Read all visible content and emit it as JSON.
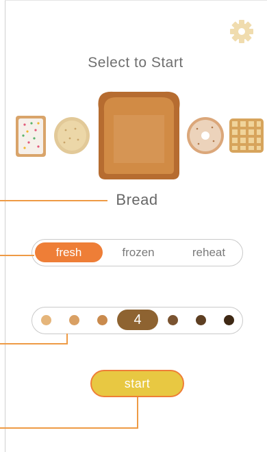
{
  "header": {
    "title": "Select to Start",
    "settings_icon": "gear-icon"
  },
  "carousel": {
    "items": [
      {
        "name": "toaster-pastry"
      },
      {
        "name": "english-muffin"
      },
      {
        "name": "bread",
        "selected": true
      },
      {
        "name": "bagel"
      },
      {
        "name": "waffle"
      }
    ],
    "selected_label": "Bread"
  },
  "mode": {
    "options": [
      "fresh",
      "frozen",
      "reheat"
    ],
    "selected": "fresh"
  },
  "shade": {
    "selected_value": "4",
    "levels": 7,
    "colors": [
      "#e5b57a",
      "#d9a064",
      "#c98a4d",
      "#8e6331",
      "#7a5330",
      "#5e3f22",
      "#3e2814"
    ]
  },
  "actions": {
    "start_label": "start"
  },
  "colors": {
    "accent": "#ee7e37",
    "start_fill": "#e8c842",
    "leader": "#ee9a44"
  }
}
